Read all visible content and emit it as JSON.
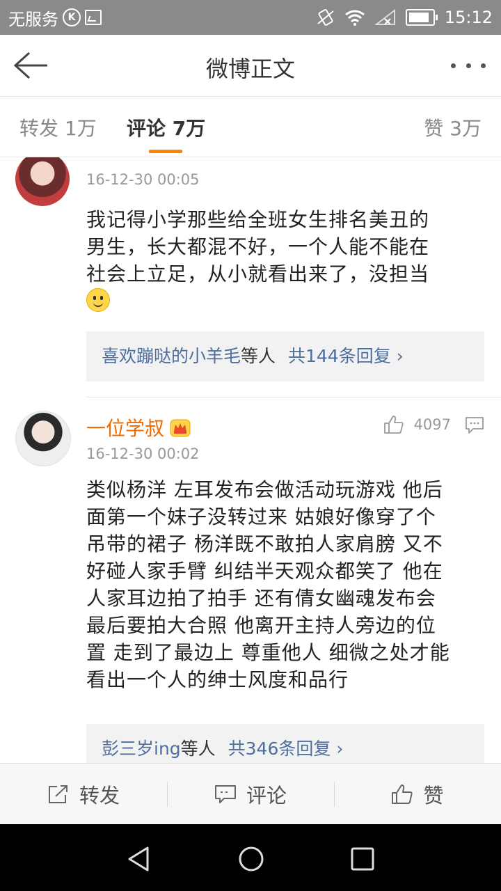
{
  "status_bar": {
    "carrier": "无服务",
    "time": "15:12",
    "icons": [
      "k-circle-icon",
      "image-icon",
      "vibrate-icon",
      "wifi-icon",
      "signal-icon",
      "battery-icon"
    ]
  },
  "nav": {
    "title": "微博正文",
    "back_icon": "back-arrow-icon",
    "more_icon": "more-dots-icon"
  },
  "tabs": {
    "repost": "转发 1万",
    "comment": "评论 7万",
    "like": "赞 3万",
    "active": "comment",
    "accent": "#ff8200"
  },
  "comments": [
    {
      "timestamp": "16-12-30 00:05",
      "text_lines": [
        "我记得小学那些给全班女生排名美丑的",
        "男生，长大都混不好，一个人能不能在",
        "社会上立足，从小就看出来了，没担当"
      ],
      "replies_user": "喜欢蹦哒的小羊毛",
      "replies_mid": "等人",
      "replies_count": "共144条回复",
      "chevron": "›"
    },
    {
      "username": "一位学叔",
      "likes": "4097",
      "timestamp": "16-12-30 00:02",
      "text_lines": [
        "类似杨洋 左耳发布会做活动玩游戏 他后",
        "面第一个妹子没转过来 姑娘好像穿了个",
        "吊带的裙子 杨洋既不敢拍人家肩膀 又不",
        "好碰人家手臂 纠结半天观众都笑了 他在",
        "人家耳边拍了拍手 还有倩女幽魂发布会",
        "最后要拍大合照 他离开主持人旁边的位",
        "置 走到了最边上 尊重他人 细微之处才能",
        "看出一个人的绅士风度和品行"
      ],
      "replies_user": "彭三岁ing",
      "replies_mid": "等人",
      "replies_count": "共346条回复",
      "chevron": "›"
    }
  ],
  "actions": {
    "repost": "转发",
    "comment": "评论",
    "like": "赞"
  },
  "colors": {
    "username": "#f16b00",
    "link": "#4d6fa0"
  }
}
